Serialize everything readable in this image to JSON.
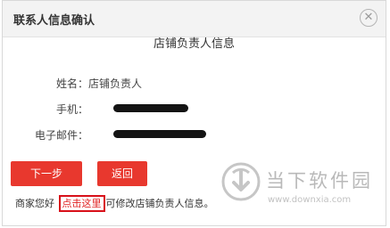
{
  "dialog": {
    "title": "联系人信息确认",
    "close_glyph": "✕",
    "heading": "店铺负责人信息",
    "fields": [
      {
        "label": "姓名：",
        "value": "店铺负责人"
      },
      {
        "label": "手机：",
        "value": ""
      },
      {
        "label": "电子邮件：",
        "value": ""
      }
    ],
    "buttons": {
      "next": "下一步",
      "back": "返回"
    },
    "footer": {
      "prefix": "商家您好",
      "link": "点击这里",
      "suffix": "可修改店铺负责人信息。"
    }
  },
  "watermark": {
    "text": "当下软件园",
    "url": "www.downxia.com"
  },
  "colors": {
    "accent": "#e8382e",
    "highlight_border": "#d8101a"
  }
}
